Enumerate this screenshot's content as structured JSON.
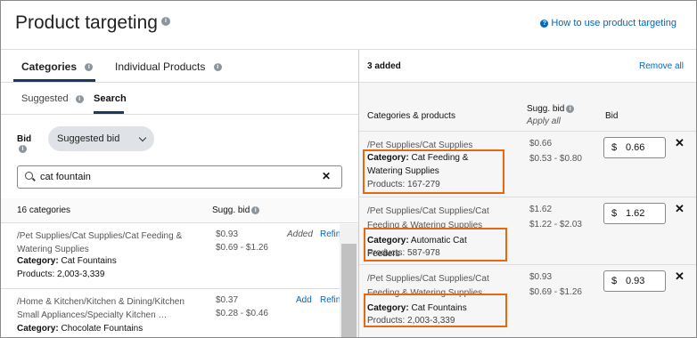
{
  "header": {
    "title": "Product targeting",
    "help_link": "How to use product targeting"
  },
  "tabs": [
    {
      "label": "Categories",
      "active": true
    },
    {
      "label": "Individual Products",
      "active": false
    }
  ],
  "subtabs": [
    {
      "label": "Suggested",
      "active": false
    },
    {
      "label": "Search",
      "active": true
    }
  ],
  "bid": {
    "label": "Bid",
    "mode": "Suggested bid"
  },
  "search": {
    "value": "cat fountain",
    "clear": "✕"
  },
  "results": {
    "count_label": "16 categories",
    "sugg_bid_header": "Sugg. bid",
    "rows": [
      {
        "path": "/Pet Supplies/Cat Supplies/Cat Feeding & Watering Supplies",
        "category_label": "Category:",
        "category": "Cat Fountains",
        "products": "Products: 2,003-3,339",
        "bid": "$0.93",
        "range": "$0.69 - $1.26",
        "action": "Added",
        "refine": "Refin"
      },
      {
        "path": "/Home & Kitchen/Kitchen & Dining/Kitchen Small Appliances/Specialty Kitchen …",
        "category_label": "Category:",
        "category": "Chocolate Fountains",
        "products": "",
        "bid": "$0.37",
        "range": "$0.28 - $0.46",
        "action": "Add",
        "refine": "Refin"
      }
    ]
  },
  "selected": {
    "count_label": "3 added",
    "remove_all": "Remove all",
    "col_categories": "Categories & products",
    "col_sugg_bid": "Sugg. bid",
    "apply_all": "Apply all",
    "col_bid": "Bid",
    "currency": "$",
    "rows": [
      {
        "path": "/Pet Supplies/Cat Supplies",
        "category_label": "Category:",
        "category": "Cat Feeding & Watering Supplies",
        "products": "Products: 167-279",
        "bid": "$0.66",
        "range": "$0.53 - $0.80",
        "bid_value": "0.66"
      },
      {
        "path": "/Pet Supplies/Cat Supplies/Cat Feeding & Watering Supplies",
        "category_label": "Category:",
        "category": "Automatic Cat Feeders",
        "products": "Products: 587-978",
        "bid": "$1.62",
        "range": "$1.22 - $2.03",
        "bid_value": "1.62"
      },
      {
        "path": "/Pet Supplies/Cat Supplies/Cat Feeding & Watering Supplies",
        "category_label": "Category:",
        "category": "Cat Fountains",
        "products": "Products: 2,003-3,339",
        "bid": "$0.93",
        "range": "$0.69 - $1.26",
        "bid_value": "0.93"
      }
    ]
  },
  "colors": {
    "accent_link": "#0066c0",
    "highlight": "#e8680f",
    "tab_underline": "#1a3a5c"
  }
}
